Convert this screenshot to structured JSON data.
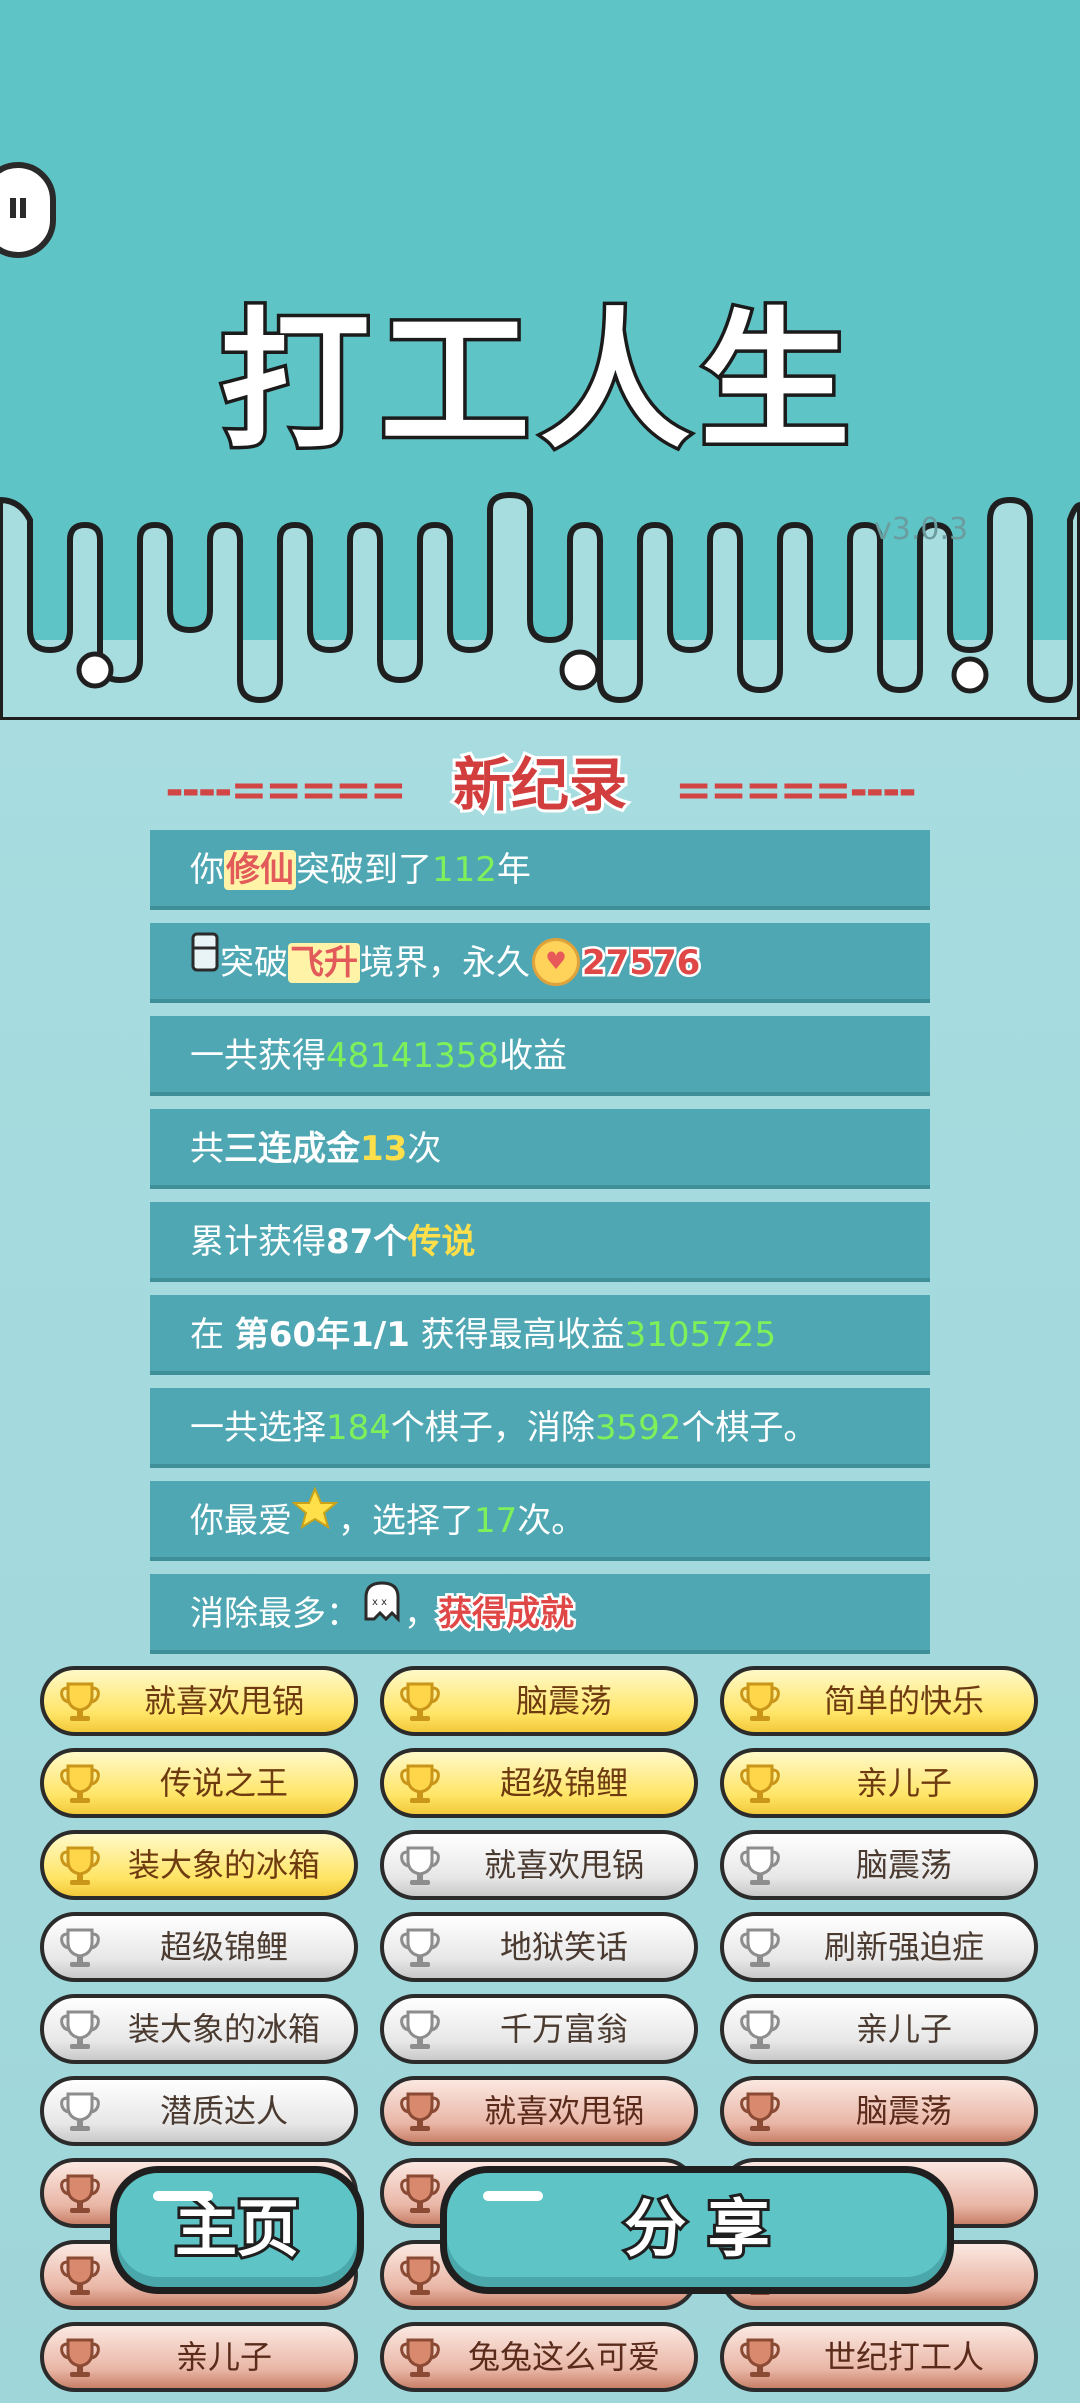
{
  "app": {
    "title": "打工人生",
    "version": "v3.0.3"
  },
  "record": {
    "heading_left": "----=====",
    "heading": "新纪录",
    "heading_right": "=====----"
  },
  "stats": [
    {
      "parts": [
        [
          "你",
          ""
        ],
        [
          "修仙",
          "hl"
        ],
        [
          "突破到了",
          ""
        ],
        [
          "112",
          "g"
        ],
        [
          "年",
          ""
        ]
      ]
    },
    {
      "parts": [
        [
          "突破",
          ""
        ],
        [
          "飞升",
          "hl"
        ],
        [
          "境界，永久",
          ""
        ],
        [
          "27576",
          "red-out"
        ]
      ]
    },
    {
      "parts": [
        [
          "一共获得",
          ""
        ],
        [
          "48141358",
          "g"
        ],
        [
          "收益",
          ""
        ]
      ]
    },
    {
      "parts": [
        [
          "共",
          ""
        ],
        [
          "三连成金",
          "w"
        ],
        [
          "13",
          "y"
        ],
        [
          "次",
          ""
        ]
      ]
    },
    {
      "parts": [
        [
          "累计获得",
          ""
        ],
        [
          "87个",
          "w"
        ],
        [
          "传说",
          "y"
        ]
      ]
    },
    {
      "parts": [
        [
          "在 ",
          ""
        ],
        [
          "第60年1/1",
          "w"
        ],
        [
          " 获得最高收益",
          ""
        ],
        [
          "3105725",
          "g"
        ]
      ]
    },
    {
      "parts": [
        [
          "一共选择",
          ""
        ],
        [
          "184",
          "g"
        ],
        [
          "个棋子，消除",
          ""
        ],
        [
          "3592",
          "g"
        ],
        [
          "个棋子。",
          ""
        ]
      ]
    },
    {
      "parts": [
        [
          "你最爱",
          ""
        ],
        [
          "，选择了",
          ""
        ],
        [
          "17",
          "g"
        ],
        [
          "次。",
          ""
        ]
      ]
    },
    {
      "parts": [
        [
          "消除最多：",
          ""
        ],
        [
          "，",
          ""
        ],
        [
          "获得成就",
          "red-out"
        ]
      ]
    }
  ],
  "achievements": [
    {
      "label": "就喜欢甩锅",
      "tier": "gold"
    },
    {
      "label": "脑震荡",
      "tier": "gold"
    },
    {
      "label": "简单的快乐",
      "tier": "gold"
    },
    {
      "label": "传说之王",
      "tier": "gold"
    },
    {
      "label": "超级锦鲤",
      "tier": "gold"
    },
    {
      "label": "亲儿子",
      "tier": "gold"
    },
    {
      "label": "装大象的冰箱",
      "tier": "gold"
    },
    {
      "label": "就喜欢甩锅",
      "tier": "silver"
    },
    {
      "label": "脑震荡",
      "tier": "silver"
    },
    {
      "label": "超级锦鲤",
      "tier": "silver"
    },
    {
      "label": "地狱笑话",
      "tier": "silver"
    },
    {
      "label": "刷新强迫症",
      "tier": "silver"
    },
    {
      "label": "装大象的冰箱",
      "tier": "silver"
    },
    {
      "label": "千万富翁",
      "tier": "silver"
    },
    {
      "label": "亲儿子",
      "tier": "silver"
    },
    {
      "label": "潜质达人",
      "tier": "silver"
    },
    {
      "label": "就喜欢甩锅",
      "tier": "bronze"
    },
    {
      "label": "脑震荡",
      "tier": "bronze"
    },
    {
      "label": "",
      "tier": "bronze"
    },
    {
      "label": "",
      "tier": "bronze"
    },
    {
      "label": "翁",
      "tier": "bronze"
    },
    {
      "label": "",
      "tier": "bronze"
    },
    {
      "label": "",
      "tier": "bronze"
    },
    {
      "label": "故",
      "tier": "bronze"
    },
    {
      "label": "亲儿子",
      "tier": "bronze"
    },
    {
      "label": "兔兔这么可爱",
      "tier": "bronze"
    },
    {
      "label": "世纪打工人",
      "tier": "bronze"
    }
  ],
  "buttons": {
    "home": "主页",
    "share": "分 享"
  },
  "colors": {
    "top_bg": "#5fc4c6",
    "row_bg": "#4ea7b2",
    "accent_red": "#d23d3d",
    "value_green": "#7ff05a"
  }
}
